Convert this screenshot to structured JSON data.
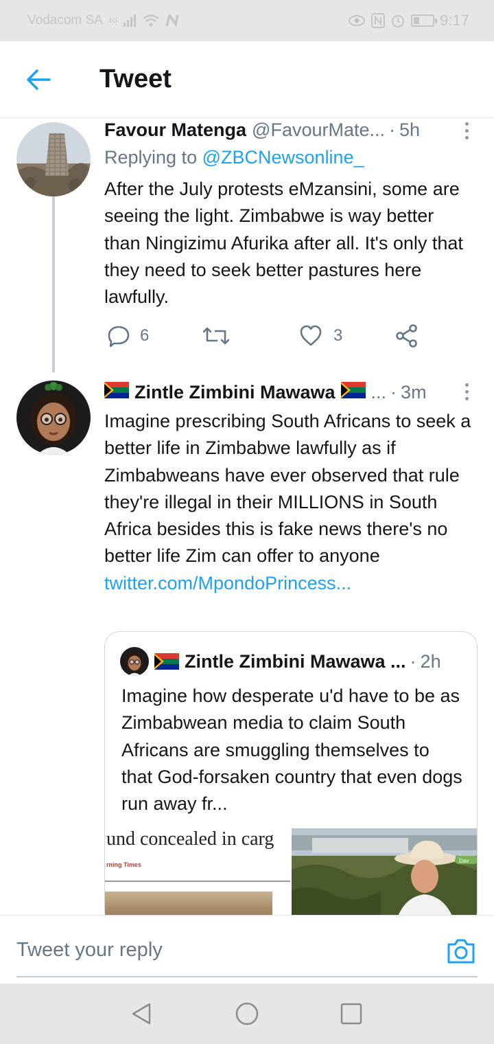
{
  "status_bar": {
    "carrier": "Vodacom SA",
    "network": "4G",
    "time": "9:17",
    "battery_level": 0.3
  },
  "header": {
    "title": "Tweet",
    "back_icon": "arrow-left-icon"
  },
  "tweets": [
    {
      "name": "Favour Matenga",
      "handle": "@FavourMate...",
      "time": "5h",
      "replying_label": "Replying to",
      "replying_to": "@ZBCNewsonline_",
      "text": "After the July protests eMzansini, some are seeing the light. Zimbabwe is way better than Ningizimu Afurika after all. It's only that they need to seek better pastures here lawfully.",
      "replies": "6",
      "likes": "3"
    },
    {
      "name": "Zintle Zimbini Mawawa",
      "handle": "...",
      "time": "3m",
      "text": "Imagine prescribing South Africans to seek a better life in Zimbabwe lawfully as if Zimbabweans have ever observed that rule they're illegal in their MILLIONS in South Africa  besides this is fake news there's no better life Zim can offer to anyone",
      "link": "twitter.com/MpondoPrincess..."
    }
  ],
  "quoted": {
    "name": "Zintle Zimbini Mawawa ...",
    "time": "2h",
    "text": "Imagine how desperate u'd have to be as Zimbabwean media to claim South Africans are smuggling themselves to that God-forsaken country that even dogs run away fr...",
    "media_headline": "und concealed in carg",
    "media_source": "rning Times",
    "media_tag": "Dav"
  },
  "reply_bar": {
    "placeholder": "Tweet your reply"
  },
  "colors": {
    "accent": "#1da1f2",
    "text": "#14171a",
    "secondary": "#657786",
    "border": "#e1e8ed"
  }
}
